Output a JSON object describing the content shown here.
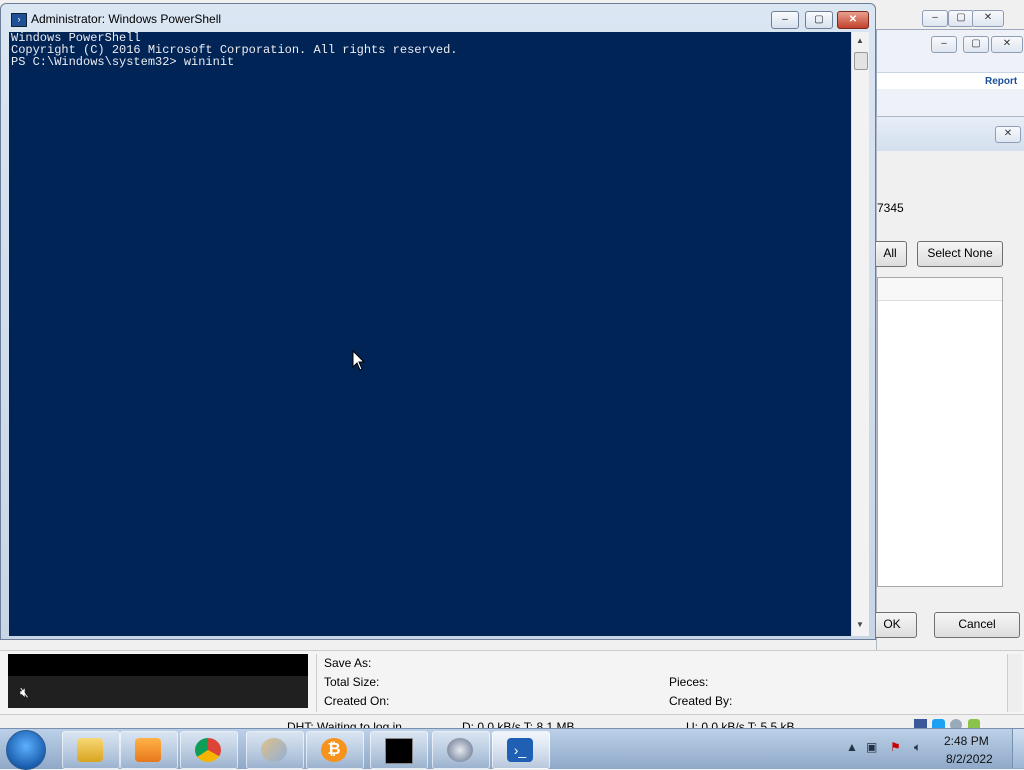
{
  "powershell": {
    "title": "Administrator: Windows PowerShell",
    "lines": [
      "Windows PowerShell",
      "Copyright (C) 2016 Microsoft Corporation. All rights reserved.",
      "",
      "PS C:\\Windows\\system32> wininit"
    ],
    "colors": {
      "console_bg": "#012456",
      "console_fg": "#eeedf0"
    }
  },
  "background_window": {
    "report_link": "Report",
    "number_fragment": "7345",
    "select_all_fragment": "All",
    "select_none": "Select None",
    "ok_fragment": "OK",
    "cancel": "Cancel"
  },
  "torrent_client": {
    "labels": {
      "save_as": "Save As:",
      "total_size": "Total Size:",
      "created_on": "Created On:",
      "pieces": "Pieces:",
      "created_by": "Created By:"
    },
    "status": {
      "dht": "DHT: Waiting to log in",
      "download": "D: 0.0 kB/s T: 8.1 MB",
      "upload": "U: 0.0 kB/s T: 5.5 kB"
    }
  },
  "taskbar": {
    "apps": [
      "file-explorer-icon",
      "media-player-icon",
      "chrome-icon",
      "paint-icon",
      "bitcoin-icon",
      "cmd-icon",
      "bittorrent-icon",
      "powershell-icon"
    ],
    "clock": {
      "time": "2:48 PM",
      "date": "8/2/2022"
    }
  }
}
